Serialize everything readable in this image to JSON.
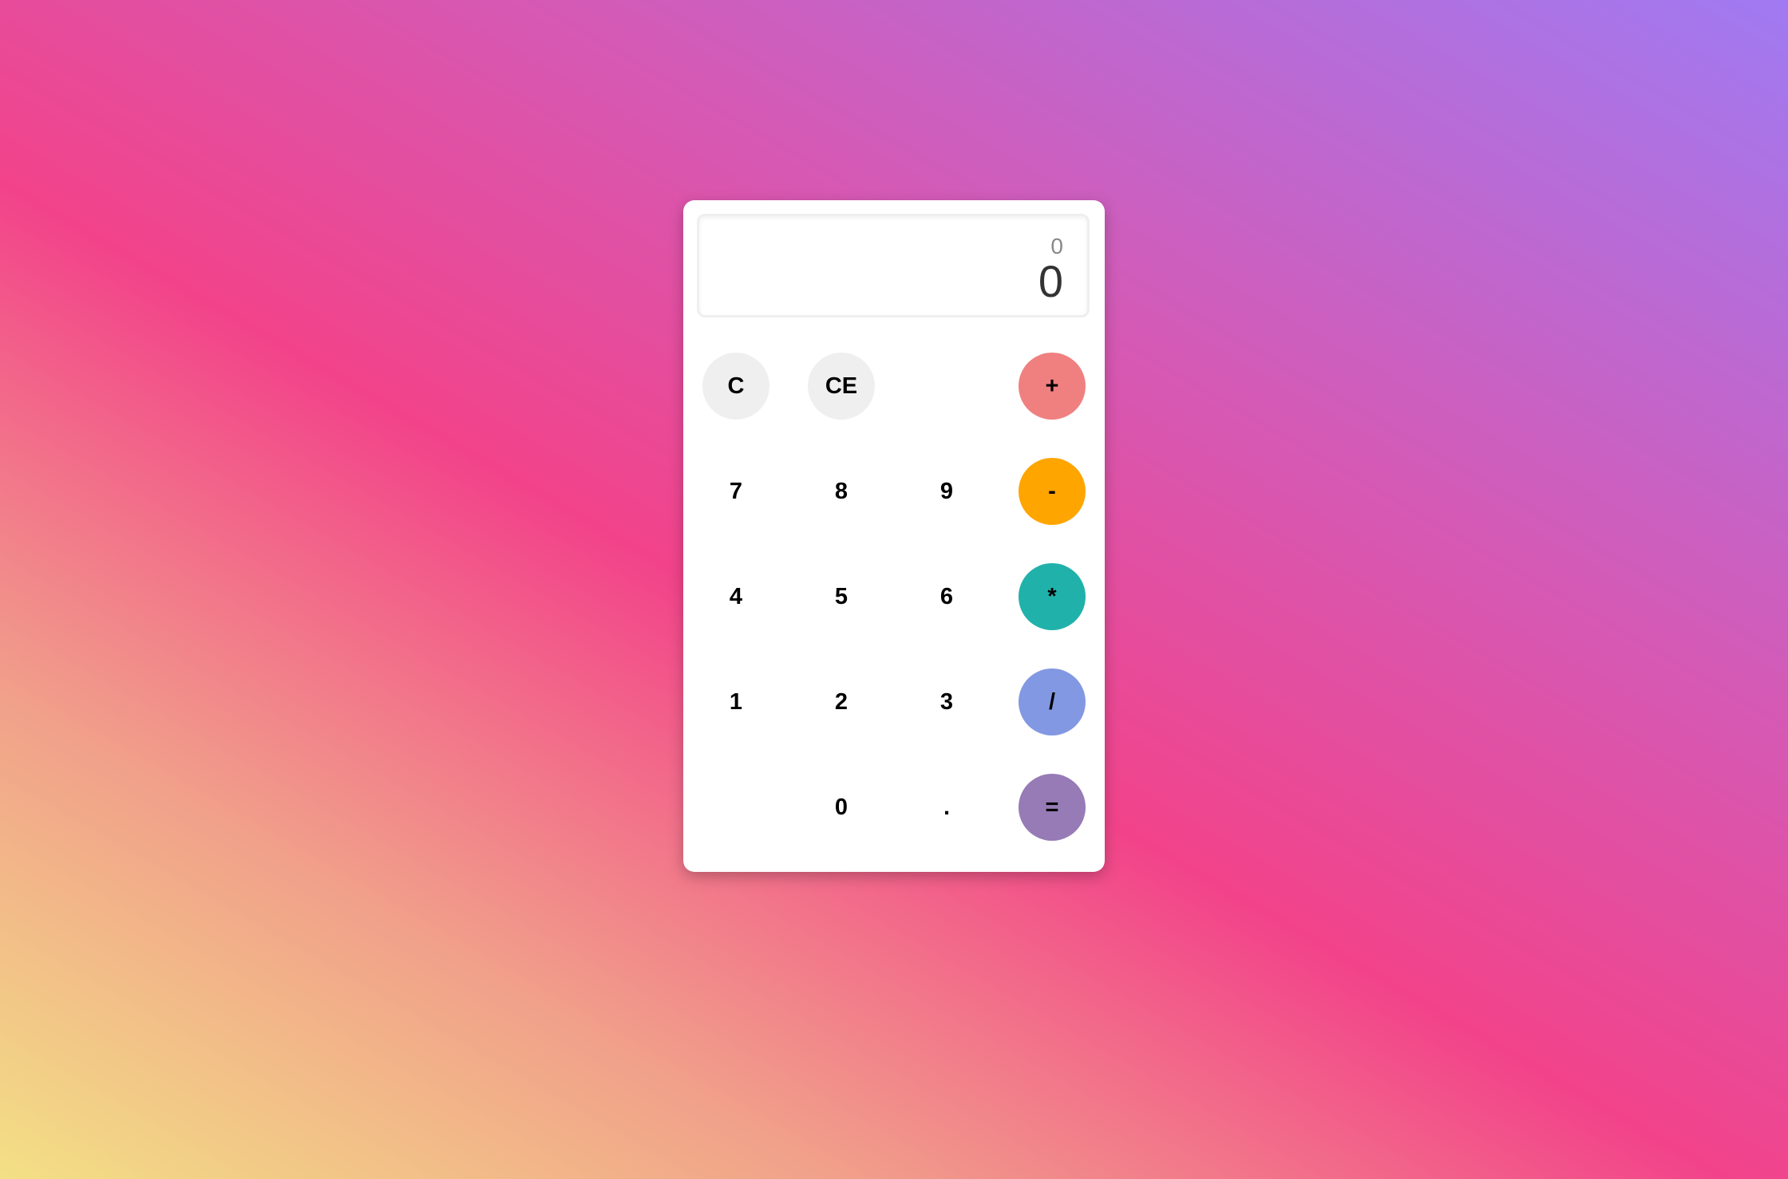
{
  "display": {
    "previous": "0",
    "current": "0"
  },
  "keys": {
    "clear": "C",
    "clear_entry": "CE",
    "add": "+",
    "subtract": "-",
    "multiply": "*",
    "divide": "/",
    "equals": "=",
    "seven": "7",
    "eight": "8",
    "nine": "9",
    "four": "4",
    "five": "5",
    "six": "6",
    "one": "1",
    "two": "2",
    "three": "3",
    "zero": "0",
    "decimal": "."
  },
  "colors": {
    "add": "#f08080",
    "subtract": "#ffa500",
    "multiply": "#20b2aa",
    "divide": "#8398e2",
    "equals": "#967bb6",
    "clear_keys": "#efefef"
  }
}
